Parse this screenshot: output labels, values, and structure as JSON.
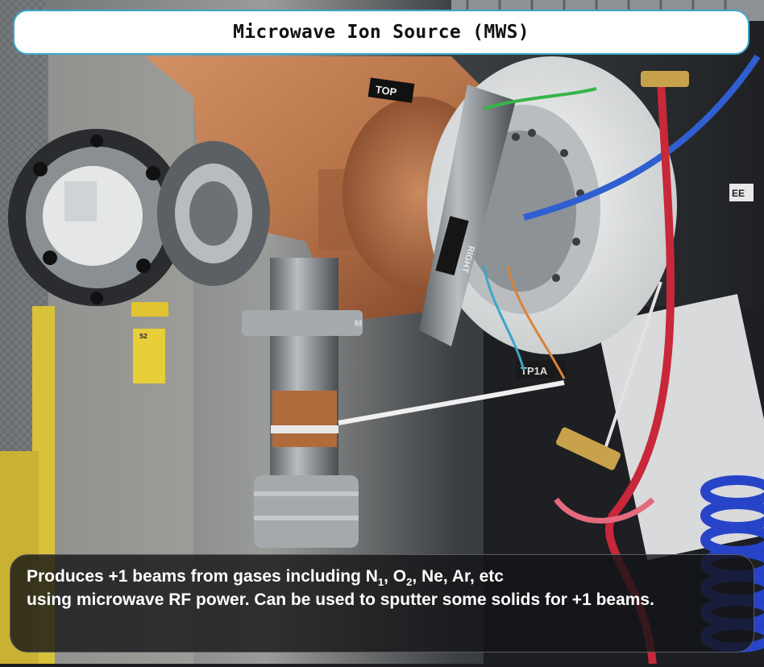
{
  "title": "Microwave Ion Source (MWS)",
  "caption": {
    "line1_prefix": "Produces +1 beams from gases including N",
    "n_sub": "1",
    "comma1": ", O",
    "o_sub": "2",
    "line1_suffix": ", Ne, Ar, etc",
    "line2": "using microwave RF power. Can be used to sputter some solids for +1 beams."
  },
  "photo_labels": {
    "top_label": "TOP",
    "right_label": "RIGHT",
    "tag_label": "TP1A",
    "ee_label": "EE",
    "small_a": "S2",
    "m_label": "M"
  },
  "colors": {
    "copper": "#b8754a",
    "steel": "#9aa0a6",
    "white_housing": "#e8eaea",
    "accent_border": "#3aa6c8",
    "red_cable": "#c8283a",
    "blue_cable": "#2f5fd0"
  }
}
